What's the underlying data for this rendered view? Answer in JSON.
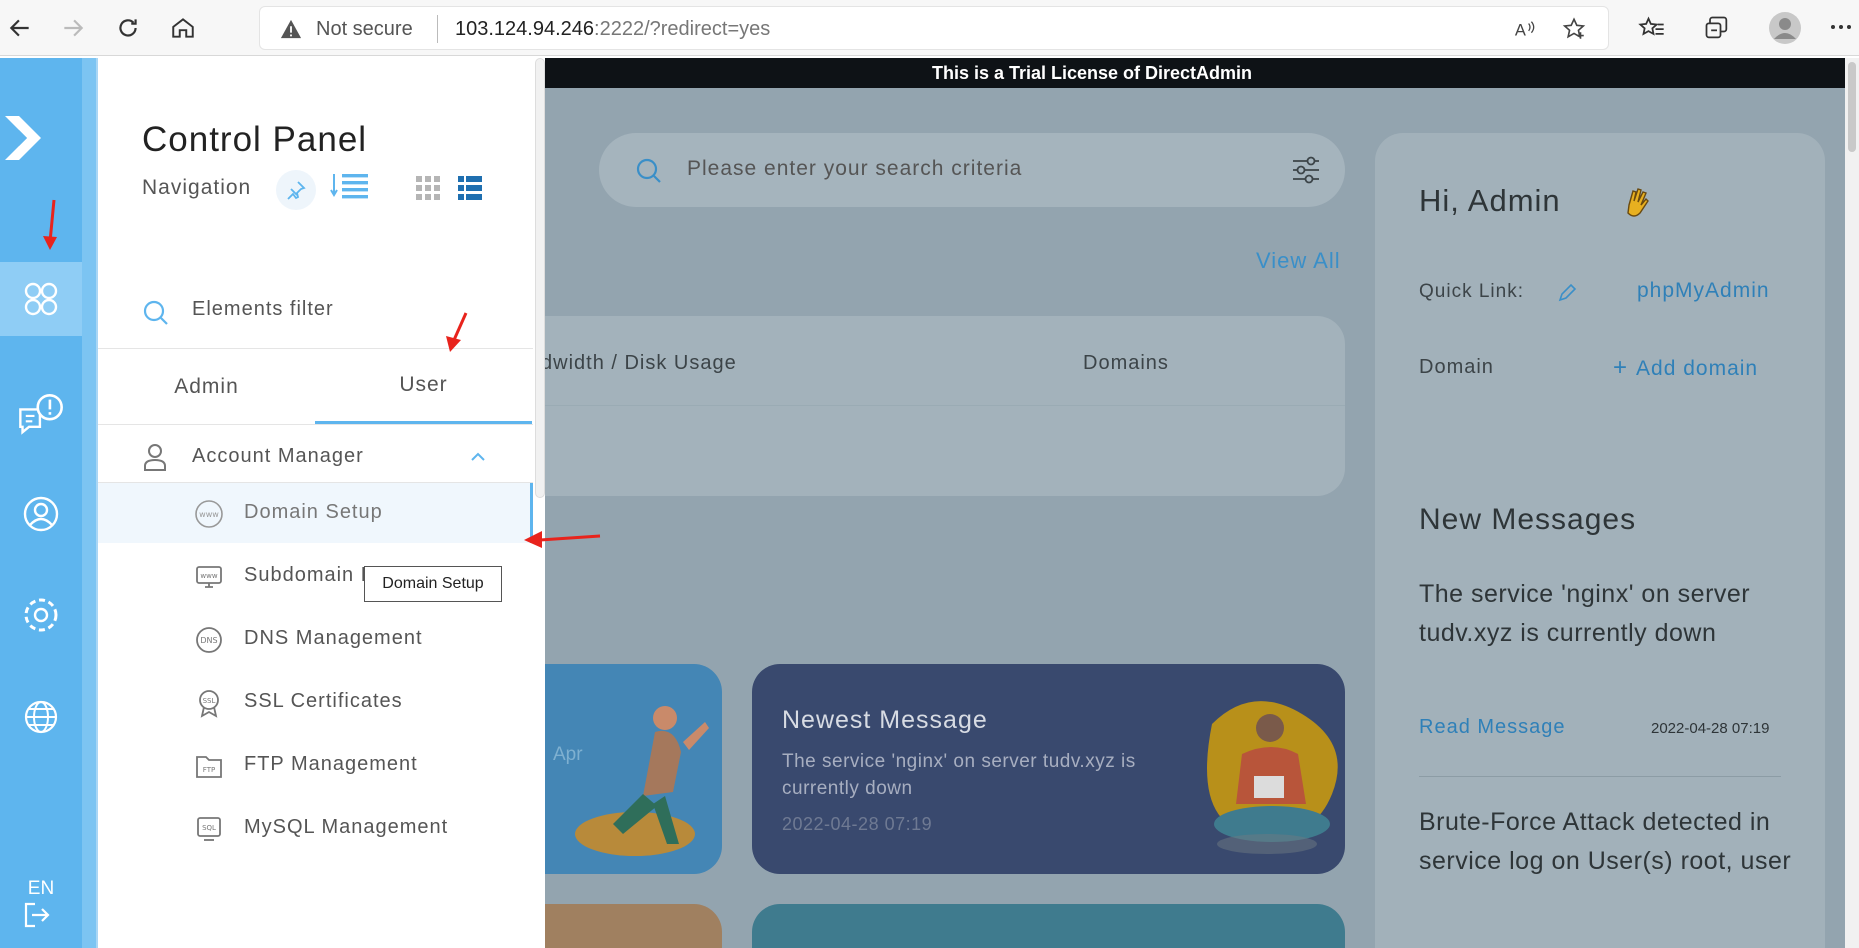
{
  "browser": {
    "security_label": "Not secure",
    "url_host": "103.124.94.246",
    "url_rest": ":2222/?redirect=yes"
  },
  "rail": {
    "items": [
      {
        "name": "dashboard-icon",
        "active": true
      },
      {
        "name": "messages-icon"
      },
      {
        "name": "user-circle-icon"
      },
      {
        "name": "settings-icon"
      },
      {
        "name": "globe-icon"
      }
    ],
    "language": "EN"
  },
  "nav": {
    "title": "Control Panel",
    "subtitle": "Navigation",
    "filter_placeholder": "Elements filter",
    "tabs": [
      {
        "label": "Admin",
        "selected": false
      },
      {
        "label": "User",
        "selected": true
      }
    ],
    "group_label": "Account Manager",
    "items": [
      {
        "label": "Domain Setup",
        "icon": "www-icon",
        "active": true
      },
      {
        "label": "Subdomain Management",
        "icon": "subdomain-icon"
      },
      {
        "label": "DNS Management",
        "icon": "dns-icon"
      },
      {
        "label": "SSL Certificates",
        "icon": "ssl-icon"
      },
      {
        "label": "FTP Management",
        "icon": "ftp-icon"
      },
      {
        "label": "MySQL Management",
        "icon": "sql-icon"
      }
    ],
    "tooltip": "Domain Setup"
  },
  "main": {
    "trial_banner": "This is a Trial License of DirectAdmin",
    "search_placeholder": "Please enter your search criteria",
    "view_all": "View All",
    "usage_columns": [
      "dwidth / Disk Usage",
      "Domains"
    ],
    "card_partial_text": "Apr",
    "newest": {
      "title": "Newest Message",
      "text": "The service 'nginx' on server tudv.xyz is currently down",
      "date": "2022-04-28 07:19"
    }
  },
  "sidebar_right": {
    "greeting": "Hi, Admin",
    "quick_link_label": "Quick Link:",
    "quick_link_value": "phpMyAdmin",
    "domain_label": "Domain",
    "add_domain": "Add domain",
    "messages_title": "New Messages",
    "message1": "The service 'nginx' on server tudv.xyz is currently down",
    "read_message": "Read Message",
    "message1_date": "2022-04-28 07:19",
    "message2": "Brute-Force Attack detected in service log on User(s) root, user"
  },
  "colors": {
    "accent": "#5eb5ee",
    "link": "#2f80b8",
    "dim_overlay": "#93a4af",
    "annotation_arrow": "#e8231c"
  }
}
